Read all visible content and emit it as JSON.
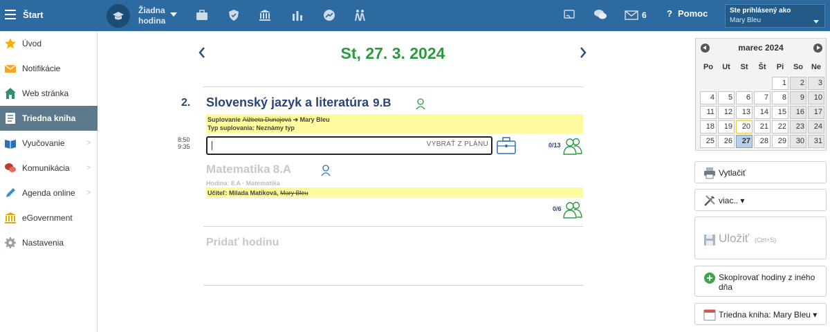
{
  "topbar": {
    "start_label": "Štart",
    "hodina_line1": "Žiadna",
    "hodina_line2": "hodina",
    "messages_count": "6",
    "help_label": "Pomoc",
    "logged_title": "Ste prihlásený ako",
    "logged_name": "Mary Bleu"
  },
  "sidebar": {
    "items": [
      {
        "label": "Úvod",
        "icon": "star-icon"
      },
      {
        "label": "Notifikácie",
        "icon": "envelope-icon"
      },
      {
        "label": "Web stránka",
        "icon": "home-icon"
      },
      {
        "label": "Triedna kniha",
        "icon": "notebook-icon"
      },
      {
        "label": "Vyučovanie",
        "icon": "book-icon"
      },
      {
        "label": "Komunikácia",
        "icon": "chat-icon"
      },
      {
        "label": "Agenda online",
        "icon": "pencil-icon"
      },
      {
        "label": "eGovernment",
        "icon": "institution-icon"
      },
      {
        "label": "Nastavenia",
        "icon": "gear-icon"
      }
    ]
  },
  "main": {
    "date_title": "St, 27. 3. 2024",
    "lesson1": {
      "number": "2.",
      "subject": "Slovenský jazyk a literatúra",
      "class": "9.B",
      "substitution_label": "Suplovanie",
      "substitution_from": "Alžbeta Dunajová",
      "substitution_to": "➔ Mary Bleu",
      "sub_type_label": "Typ suplovania:",
      "sub_type_value": "Neznámy typ",
      "time_start": "8:50",
      "time_end": "9:35",
      "plan_button": "VYBRAŤ Z PLÁNU",
      "attendance": "0/13"
    },
    "lesson2": {
      "subject": "Matematika",
      "class": "8.A",
      "hodina_label": "Hodina:",
      "hodina_value": "8.A · Matematika",
      "teacher_label": "Učiteľ:",
      "teacher_value": "Milada Matiková,",
      "teacher_struck": "Mary Bleu",
      "attendance": "0/6"
    },
    "add_lesson": "Pridať hodinu"
  },
  "calendar": {
    "month": "marec 2024",
    "dow": [
      "Po",
      "Ut",
      "St",
      "Št",
      "Pi",
      "So",
      "Ne"
    ],
    "weeks": [
      [
        "",
        "",
        "",
        "",
        "1",
        "2",
        "3"
      ],
      [
        "4",
        "5",
        "6",
        "7",
        "8",
        "9",
        "10"
      ],
      [
        "11",
        "12",
        "13",
        "14",
        "15",
        "16",
        "17"
      ],
      [
        "18",
        "19",
        "20",
        "21",
        "22",
        "23",
        "24"
      ],
      [
        "25",
        "26",
        "27",
        "28",
        "29",
        "30",
        "31"
      ]
    ],
    "today": "20",
    "selected": "27"
  },
  "actions": {
    "print": "Vytlačiť",
    "more": "viac.. ▾",
    "save": "Uložiť",
    "save_hint": "(Ctrl+S)",
    "copy": "Skopírovať hodiny z iného dňa",
    "classbook": "Triedna kniha: Mary Bleu ▾"
  },
  "colors": {
    "topbar": "#2d6a9f",
    "date_green": "#2a9a3f",
    "highlight_yellow": "#fefb9e",
    "active_sidebar": "#5d7a8d"
  }
}
